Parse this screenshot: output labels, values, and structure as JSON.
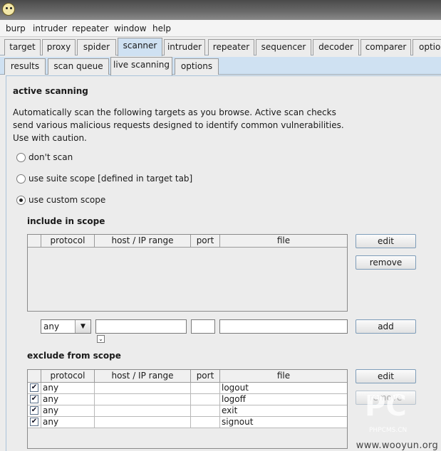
{
  "menu": [
    "burp",
    "intruder",
    "repeater",
    "window",
    "help"
  ],
  "main_tabs": [
    "target",
    "proxy",
    "spider",
    "scanner",
    "intruder",
    "repeater",
    "sequencer",
    "decoder",
    "comparer",
    "options"
  ],
  "selected_main_tab": "scanner",
  "sub_tabs": [
    "results",
    "scan queue",
    "live scanning",
    "options"
  ],
  "selected_sub_tab": "live scanning",
  "active_scanning": {
    "heading": "active scanning",
    "description": "Automatically scan the following targets as you browse. Active scan checks send various malicious requests designed to identify common vulnerabilities. Use with caution.",
    "options": [
      {
        "label": "don't scan",
        "selected": false
      },
      {
        "label": "use suite scope [defined in target tab]",
        "selected": false
      },
      {
        "label": "use custom scope",
        "selected": true
      }
    ]
  },
  "include": {
    "heading": "include in scope",
    "columns": [
      "protocol",
      "host / IP range",
      "port",
      "file"
    ],
    "rows": [],
    "buttons": {
      "edit": "edit",
      "remove": "remove"
    },
    "add_row": {
      "protocol_value": "any",
      "host": "",
      "port": "",
      "file": "",
      "add_label": "add"
    }
  },
  "exclude": {
    "heading": "exclude from scope",
    "columns": [
      "protocol",
      "host / IP range",
      "port",
      "file"
    ],
    "rows": [
      {
        "enabled": true,
        "protocol": "any",
        "host": "",
        "port": "",
        "file": "logout"
      },
      {
        "enabled": true,
        "protocol": "any",
        "host": "",
        "port": "",
        "file": "logoff"
      },
      {
        "enabled": true,
        "protocol": "any",
        "host": "",
        "port": "",
        "file": "exit"
      },
      {
        "enabled": true,
        "protocol": "any",
        "host": "",
        "port": "",
        "file": "signout"
      }
    ],
    "buttons": {
      "edit": "edit",
      "remove": "remove"
    }
  },
  "watermark": {
    "site": "www.wooyun.org",
    "logo_text": "PC",
    "logo_sub": "PHPCMS.CN"
  }
}
